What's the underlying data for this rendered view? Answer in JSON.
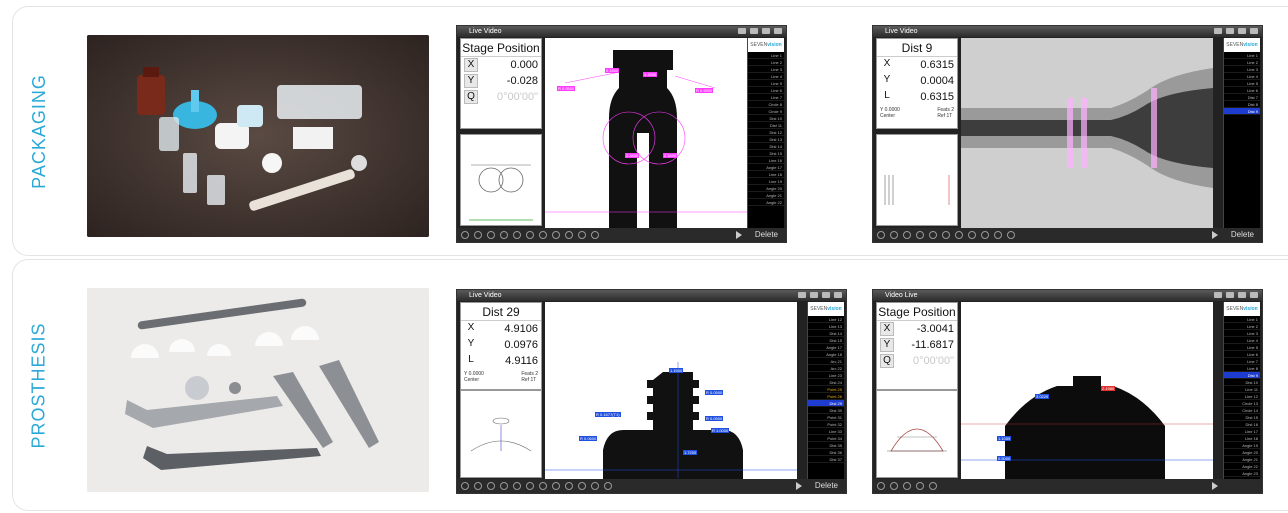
{
  "categories": [
    {
      "label": "PACKAGING",
      "shots": [
        {
          "window_title": "Live Video",
          "dro_title": "Stage Position",
          "readouts": [
            {
              "axis": "X",
              "value": "0.000"
            },
            {
              "axis": "Y",
              "value": "-0.028"
            },
            {
              "axis": "Q",
              "value": "0°00'00\""
            }
          ],
          "footer": null,
          "button": "Delete"
        },
        {
          "window_title": "Live Video",
          "dro_title": "Dist 9",
          "readouts": [
            {
              "axis": "X",
              "value": "0.6315"
            },
            {
              "axis": "Y",
              "value": "0.0004"
            },
            {
              "axis": "L",
              "value": "0.6315"
            }
          ],
          "footer": {
            "left": "Y 0.0000\nCenter",
            "right": "Feats 2\nRef 1T"
          },
          "button": "Delete"
        }
      ]
    },
    {
      "label": "PROSTHESIS",
      "shots": [
        {
          "window_title": "Live Video",
          "dro_title": "Dist 29",
          "readouts": [
            {
              "axis": "X",
              "value": "4.9106"
            },
            {
              "axis": "Y",
              "value": "0.0976"
            },
            {
              "axis": "L",
              "value": "4.9116"
            }
          ],
          "footer": {
            "left": "Y 0.0000\nCenter",
            "right": "Feats 2\nRef 1T"
          },
          "button": "Delete"
        },
        {
          "window_title": "Video Live",
          "dro_title": "Stage Position",
          "readouts": [
            {
              "axis": "X",
              "value": "-3.0041"
            },
            {
              "axis": "Y",
              "value": "-11.6817"
            },
            {
              "axis": "Q",
              "value": "0°00'00\""
            }
          ],
          "footer": null,
          "button": ""
        }
      ]
    }
  ],
  "feature_lists": {
    "pkg1": [
      "Line 1",
      "Line 2",
      "Line 3",
      "Line 4",
      "Line 5",
      "Line 6",
      "Line 7",
      "Circle 8",
      "Circle 9",
      "Dist 10",
      "Dist 11",
      "Dist 12",
      "Dist 13",
      "Dist 14",
      "Dist 15",
      "Line 16",
      "Angle 17",
      "Line 18",
      "Line 19",
      "Angle 20",
      "Angle 21",
      "Angle 22"
    ],
    "pkg2": [
      "Line 1",
      "Line 2",
      "Line 3",
      "Line 4",
      "Line 5",
      "Line 6",
      "Dist 7",
      "Dist 8",
      "Dist 9"
    ],
    "pro1": [
      "Line 12",
      "Line 13",
      "Dist 14",
      "Dist 15",
      "Angle 17",
      "Angle 18",
      "Arc 21",
      "Arc 22",
      "Line 23",
      "Dist 24",
      "Point 25",
      "Point 26",
      "Dist 29",
      "Dist 30",
      "Point 31",
      "Point 32",
      "Line 33",
      "Point 34",
      "Dist 35",
      "Dist 36",
      "Dist 37"
    ],
    "pro2": [
      "Line 1",
      "Line 2",
      "Line 3",
      "Line 4",
      "Line 5",
      "Line 6",
      "Line 7",
      "Line 8",
      "Dist 9",
      "Dist 10",
      "Line 11",
      "Line 12",
      "Circle 13",
      "Circle 14",
      "Dist 15",
      "Dist 16",
      "Line 17",
      "Line 18",
      "Angle 19",
      "Angle 20",
      "Angle 21",
      "Angle 22",
      "Angle 23"
    ]
  },
  "logo_text": "SEVEN",
  "logo_accent": "vision",
  "colors": {
    "accent": "#2aa9d8",
    "selection": "#1f3cd0",
    "dimension": "#ff3cff"
  }
}
